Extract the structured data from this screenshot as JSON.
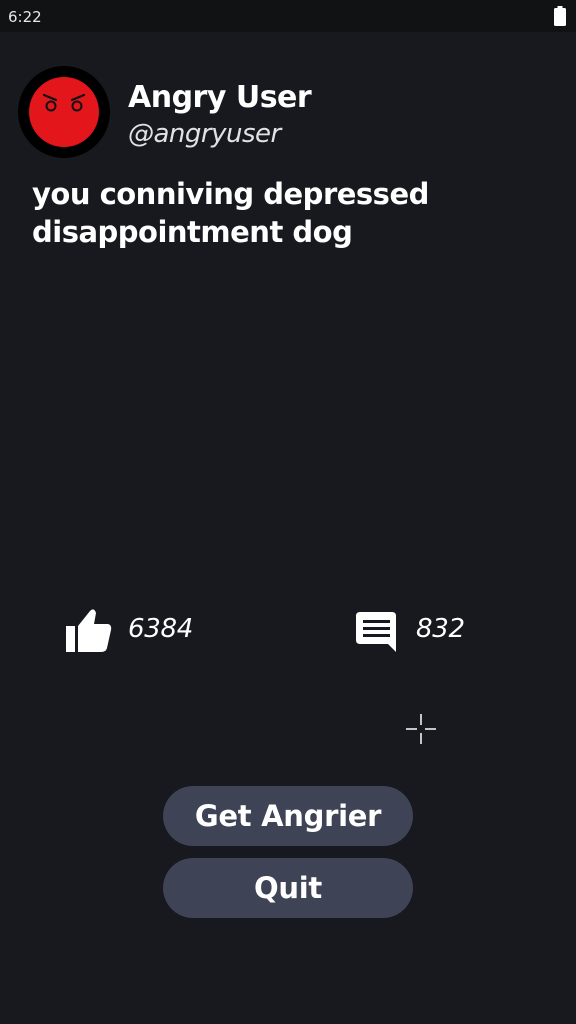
{
  "status_bar": {
    "time": "6:22",
    "battery_icon": "battery-full-icon"
  },
  "profile": {
    "avatar_icon": "angry-face-icon",
    "avatar_color": "#e3161b",
    "name": "Angry User",
    "handle": "@angryuser"
  },
  "post": {
    "text": "you conniving depressed disappointment dog"
  },
  "stats": {
    "likes_icon": "thumbs-up-icon",
    "likes": "6384",
    "comments_icon": "comment-icon",
    "comments": "832"
  },
  "actions": {
    "get_angrier_label": "Get Angrier",
    "quit_label": "Quit"
  },
  "colors": {
    "background": "#18191e",
    "button": "#3e4356",
    "text": "#ffffff"
  }
}
